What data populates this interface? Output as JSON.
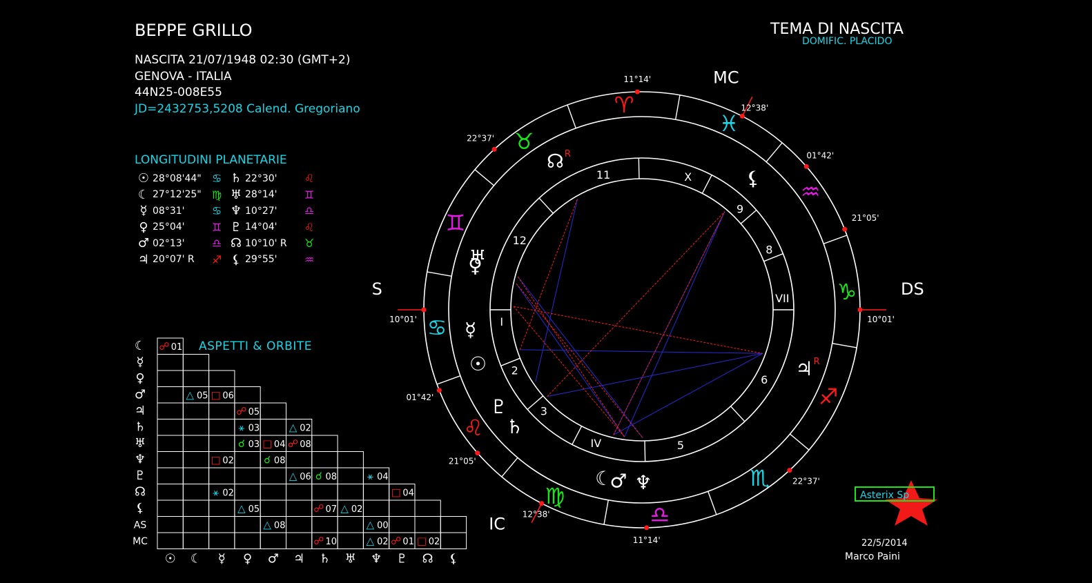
{
  "header": {
    "name": "BEPPE GRILLO",
    "birth": "NASCITA 21/07/1948 02:30 (GMT+2)",
    "place": "GENOVA - ITALIA",
    "coords": "44N25-008E55",
    "jd": "JD=2432753,5208  Calend. Gregoriano",
    "chart_title": "TEMA DI NASCITA",
    "house_system": "DOMIFIC. PLACIDO"
  },
  "longitudes": {
    "title": "LONGITUDINI PLANETARIE",
    "left": [
      {
        "glyph": "☉",
        "value": "28°08'44\"",
        "sign": "♋",
        "color": "#19d6e6"
      },
      {
        "glyph": "☾",
        "value": "27°12'25\"",
        "sign": "♍",
        "color": "#19e619"
      },
      {
        "glyph": "☿",
        "value": "08°31'",
        "sign": "♋",
        "color": "#19d6e6"
      },
      {
        "glyph": "♀",
        "value": "25°04'",
        "sign": "♊",
        "color": "#e619e6"
      },
      {
        "glyph": "♂",
        "value": "02°13'",
        "sign": "♎",
        "color": "#e619e6"
      },
      {
        "glyph": "♃",
        "value": "20°07' R",
        "sign": "♐",
        "color": "#ff1a1a"
      }
    ],
    "right": [
      {
        "glyph": "♄",
        "value": "22°30'",
        "sign": "♌",
        "color": "#ff1a1a"
      },
      {
        "glyph": "♅",
        "value": "28°14'",
        "sign": "♊",
        "color": "#e619e6"
      },
      {
        "glyph": "♆",
        "value": "10°27'",
        "sign": "♎",
        "color": "#e619e6"
      },
      {
        "glyph": "♇",
        "value": "14°04'",
        "sign": "♌",
        "color": "#ff1a1a"
      },
      {
        "glyph": "☊",
        "value": "10°10' R",
        "sign": "♉",
        "color": "#19e619"
      },
      {
        "glyph": "⚸",
        "value": "29°55'",
        "sign": "♒",
        "color": "#e619e6"
      }
    ]
  },
  "aspects": {
    "title": "ASPETTI  &  ORBITE",
    "row_labels": [
      "☾",
      "☿",
      "♀",
      "♂",
      "♃",
      "♄",
      "♅",
      "♆",
      "♇",
      "☊",
      "⚸",
      "AS",
      "MC"
    ],
    "col_labels": [
      "☉",
      "☾",
      "☿",
      "♀",
      "♂",
      "♃",
      "♄",
      "♅",
      "♆",
      "♇",
      "☊",
      "⚸"
    ],
    "cells": [
      {
        "r": 0,
        "c": 0,
        "sym": "☍",
        "val": "01",
        "color": "#ff1a1a"
      },
      {
        "r": 3,
        "c": 1,
        "sym": "△",
        "val": "05",
        "color": "#19d6e6"
      },
      {
        "r": 3,
        "c": 2,
        "sym": "□",
        "val": "06",
        "color": "#ff1a1a"
      },
      {
        "r": 4,
        "c": 3,
        "sym": "☍",
        "val": "05",
        "color": "#ff1a1a"
      },
      {
        "r": 5,
        "c": 3,
        "sym": "⚹",
        "val": "03",
        "color": "#19d6e6"
      },
      {
        "r": 5,
        "c": 5,
        "sym": "△",
        "val": "02",
        "color": "#19d6e6"
      },
      {
        "r": 6,
        "c": 3,
        "sym": "☌",
        "val": "03",
        "color": "#19e619"
      },
      {
        "r": 6,
        "c": 4,
        "sym": "□",
        "val": "04",
        "color": "#ff1a1a"
      },
      {
        "r": 6,
        "c": 5,
        "sym": "☍",
        "val": "08",
        "color": "#ff1a1a"
      },
      {
        "r": 7,
        "c": 2,
        "sym": "□",
        "val": "02",
        "color": "#ff1a1a"
      },
      {
        "r": 7,
        "c": 4,
        "sym": "☌",
        "val": "08",
        "color": "#19e619"
      },
      {
        "r": 8,
        "c": 5,
        "sym": "△",
        "val": "06",
        "color": "#19d6e6"
      },
      {
        "r": 8,
        "c": 6,
        "sym": "☌",
        "val": "08",
        "color": "#19e619"
      },
      {
        "r": 8,
        "c": 8,
        "sym": "⚹",
        "val": "04",
        "color": "#19d6e6"
      },
      {
        "r": 9,
        "c": 2,
        "sym": "⚹",
        "val": "02",
        "color": "#19d6e6"
      },
      {
        "r": 9,
        "c": 9,
        "sym": "□",
        "val": "04",
        "color": "#ff1a1a"
      },
      {
        "r": 10,
        "c": 3,
        "sym": "△",
        "val": "05",
        "color": "#19d6e6"
      },
      {
        "r": 10,
        "c": 6,
        "sym": "☍",
        "val": "07",
        "color": "#ff1a1a"
      },
      {
        "r": 10,
        "c": 7,
        "sym": "△",
        "val": "02",
        "color": "#19d6e6"
      },
      {
        "r": 11,
        "c": 4,
        "sym": "△",
        "val": "08",
        "color": "#19d6e6"
      },
      {
        "r": 11,
        "c": 8,
        "sym": "△",
        "val": "00",
        "color": "#19d6e6"
      },
      {
        "r": 12,
        "c": 6,
        "sym": "☍",
        "val": "10",
        "color": "#ff1a1a"
      },
      {
        "r": 12,
        "c": 8,
        "sym": "△",
        "val": "02",
        "color": "#19d6e6"
      },
      {
        "r": 12,
        "c": 9,
        "sym": "☍",
        "val": "01",
        "color": "#ff1a1a"
      },
      {
        "r": 12,
        "c": 10,
        "sym": "□",
        "val": "02",
        "color": "#ff1a1a"
      }
    ]
  },
  "wheel": {
    "axes": {
      "as": "AS",
      "ds": "DS",
      "mc": "MC",
      "ic": "IC"
    },
    "cusp_labels": {
      "as": "10°01'",
      "ds": "10°01'",
      "mc": "12°38'",
      "ic": "12°38'",
      "c11": "11°14'",
      "c12": "22°37'",
      "c2": "01°42'",
      "c3": "21°05'",
      "c5": "11°14'",
      "c6": "22°37'",
      "c8": "21°05'",
      "c9": "01°42'"
    },
    "signs": [
      {
        "glyph": "♊",
        "color": "#e619e6"
      },
      {
        "glyph": "♉",
        "color": "#19e619"
      },
      {
        "glyph": "♈",
        "color": "#ff1a1a"
      },
      {
        "glyph": "♓",
        "color": "#19d6e6"
      },
      {
        "glyph": "♒",
        "color": "#e619e6"
      },
      {
        "glyph": "♑",
        "color": "#19e619"
      },
      {
        "glyph": "♐",
        "color": "#ff1a1a"
      },
      {
        "glyph": "♏",
        "color": "#19d6e6"
      },
      {
        "glyph": "♎",
        "color": "#e619e6"
      },
      {
        "glyph": "♍",
        "color": "#19e619"
      },
      {
        "glyph": "♌",
        "color": "#ff1a1a"
      },
      {
        "glyph": "♋",
        "color": "#19d6e6"
      }
    ],
    "house_numbers": [
      "I",
      "2",
      "3",
      "IV",
      "5",
      "6",
      "VII",
      "8",
      "9",
      "X",
      "11",
      "12"
    ],
    "planets": [
      {
        "glyph": "⚸",
        "retro": ""
      },
      {
        "glyph": "☾",
        "retro": ""
      },
      {
        "glyph": "♃",
        "retro": "R"
      },
      {
        "glyph": "☊",
        "retro": "R"
      },
      {
        "glyph": "♀",
        "retro": ""
      },
      {
        "glyph": "♅",
        "retro": ""
      },
      {
        "glyph": "☿",
        "retro": ""
      },
      {
        "glyph": "☉",
        "retro": ""
      },
      {
        "glyph": "♇",
        "retro": ""
      },
      {
        "glyph": "♄",
        "retro": ""
      },
      {
        "glyph": "♂",
        "retro": ""
      },
      {
        "glyph": "♆",
        "retro": ""
      }
    ]
  },
  "footer": {
    "logo_text": "Asterix Sp",
    "date": "22/5/2014",
    "author": "Marco Paini"
  },
  "colors": {
    "cyan": "#19d6e6",
    "red": "#ff1a1a",
    "green": "#19e619",
    "magenta": "#e619e6",
    "blue": "#2a2ad6"
  }
}
